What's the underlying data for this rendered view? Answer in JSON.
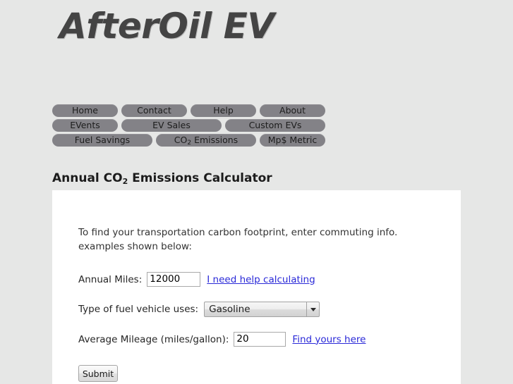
{
  "site": {
    "title": "AfterOil EV"
  },
  "nav": {
    "rows": [
      [
        {
          "label": "Home"
        },
        {
          "label": "Contact"
        },
        {
          "label": "Help"
        },
        {
          "label": "About"
        }
      ],
      [
        {
          "label": "EVents"
        },
        {
          "label": "EV Sales"
        },
        {
          "label": "Custom EVs"
        }
      ],
      [
        {
          "label": "Fuel Savings"
        },
        {
          "label_main": "CO",
          "label_sub": "2",
          "label_tail": " Emissions"
        },
        {
          "label": "Mp$ Metric"
        }
      ]
    ]
  },
  "heading": {
    "prefix": "Annual CO",
    "sub": "2",
    "suffix": " Emissions Calculator"
  },
  "form": {
    "intro": "To find your transportation carbon footprint, enter commuting info. examples shown below:",
    "annual_miles": {
      "label": "Annual Miles:",
      "value": "12000",
      "placeholder": "",
      "link": "I need help calculating"
    },
    "fuel_type": {
      "label": "Type of fuel vehicle uses:",
      "selected": "Gasoline",
      "arrow_icon": "chevron-down-icon"
    },
    "average_mileage": {
      "label": "Average Mileage (miles/gallon):",
      "value": "20",
      "placeholder": "",
      "link": "Find yours here"
    },
    "submit_label": "Submit"
  },
  "colors": {
    "page_background": "#e6e7e6",
    "panel_background": "#ffffff",
    "nav_button": "#838287",
    "link": "#2a29d8",
    "title_text": "#444444"
  }
}
